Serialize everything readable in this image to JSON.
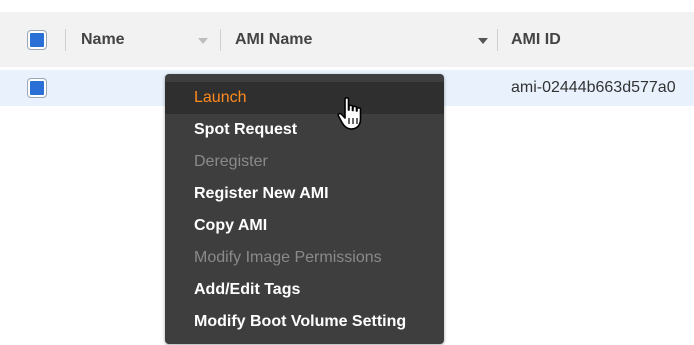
{
  "table": {
    "columns": [
      "Name",
      "AMI Name",
      "AMI ID"
    ],
    "row": {
      "ami_id": "ami-02444b663d577a0"
    }
  },
  "context_menu": {
    "items": [
      {
        "label": "Launch",
        "state": "hover"
      },
      {
        "label": "Spot Request",
        "state": "enabled"
      },
      {
        "label": "Deregister",
        "state": "disabled"
      },
      {
        "label": "Register New AMI",
        "state": "enabled"
      },
      {
        "label": "Copy AMI",
        "state": "enabled"
      },
      {
        "label": "Modify Image Permissions",
        "state": "disabled"
      },
      {
        "label": "Add/Edit Tags",
        "state": "enabled"
      },
      {
        "label": "Modify Boot Volume Setting",
        "state": "enabled"
      }
    ]
  },
  "colors": {
    "accent": "#ff8a1e",
    "menu_bg": "#3e3e3e",
    "selected_row": "#e8f1fc",
    "checkbox": "#2a6fd6"
  },
  "cursor": {
    "icon": "hand-pointer-icon"
  }
}
